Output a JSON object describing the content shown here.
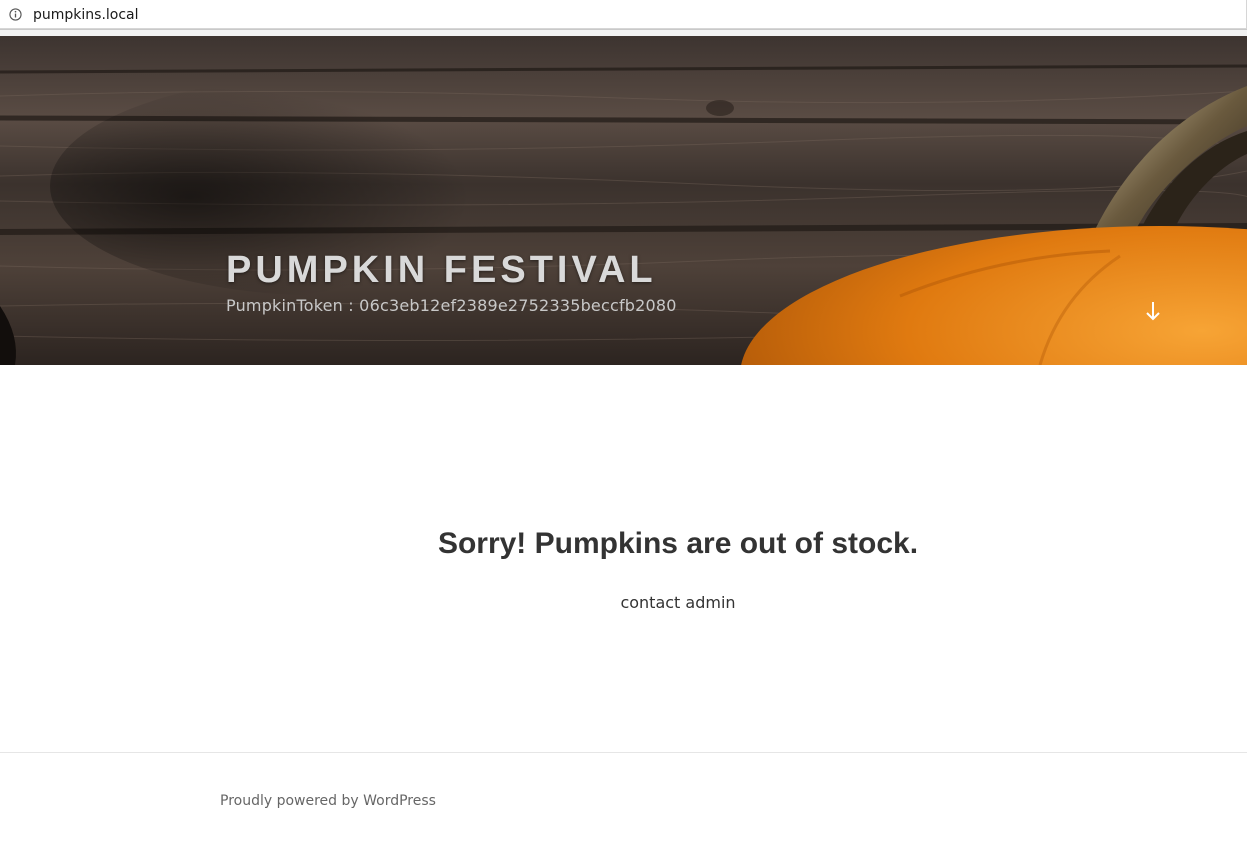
{
  "browser": {
    "url": "pumpkins.local",
    "info_icon": "info-icon"
  },
  "header": {
    "site_title": "PUMPKIN FESTIVAL",
    "site_description": "PumpkinToken : 06c3eb12ef2389e2752335beccfb2080",
    "scroll_icon": "arrow-down-icon"
  },
  "main": {
    "headline": "Sorry! Pumpkins are out of stock.",
    "subline": "contact admin"
  },
  "footer": {
    "powered_by": "Proudly powered by WordPress"
  },
  "colors": {
    "pumpkin": "#e07a10",
    "wood_dark": "#2c2420",
    "text": "#333333"
  }
}
